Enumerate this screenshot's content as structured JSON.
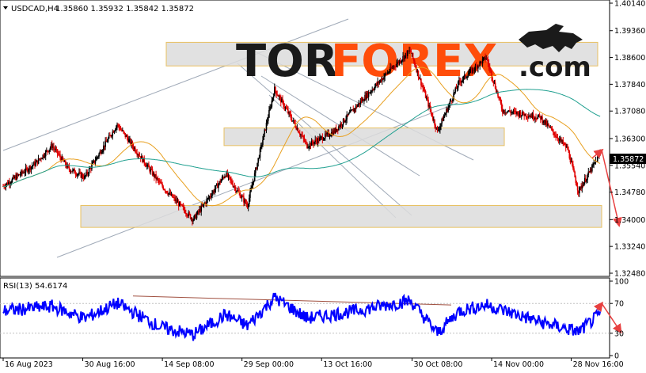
{
  "header": {
    "symbol": "USDCAD,H4",
    "ohlc": "1.35860 1.35932 1.35842 1.35872",
    "indicator": "RSI(13) 54.6174"
  },
  "logo": {
    "part1": "TOR",
    "part2": "FOREX",
    "part3": ".com"
  },
  "price_axis": {
    "ticks": [
      "1.40140",
      "1.39360",
      "1.38600",
      "1.37840",
      "1.37080",
      "1.36300",
      "1.35540",
      "1.34780",
      "1.34000",
      "1.33240",
      "1.32480"
    ],
    "current": "1.35872"
  },
  "rsi_axis": {
    "ticks": [
      "100",
      "70",
      "30",
      "0"
    ]
  },
  "time_axis": {
    "labels": [
      "16 Aug 2023",
      "30 Aug 16:00",
      "14 Sep 08:00",
      "29 Sep 00:00",
      "13 Oct 16:00",
      "30 Oct 08:00",
      "14 Nov 00:00",
      "28 Nov 16:00"
    ]
  },
  "colors": {
    "bull": "#000000",
    "bear": "#e00000",
    "ma_fast": "#e8a020",
    "ma_slow": "#20a090",
    "rsi": "#0000ff",
    "zone_fill": "#dcdcdc",
    "zone_border": "#e8c060",
    "forecast_arrow": "#e84040",
    "trendline": "#a0aab8",
    "rsi_trend": "#a05040"
  },
  "chart_data": [
    {
      "type": "candlestick",
      "title": "USDCAD,H4",
      "x_range": [
        "16 Aug 2023",
        "05 Dec 2023"
      ],
      "ylim": [
        1.3248,
        1.4014
      ],
      "grid": false,
      "waypoints": [
        {
          "t": "16 Aug 2023",
          "price": 1.3495
        },
        {
          "t": "22 Aug 2023",
          "price": 1.356
        },
        {
          "t": "25 Aug 2023",
          "price": 1.361
        },
        {
          "t": "28 Aug 2023",
          "price": 1.3545
        },
        {
          "t": "31 Aug 2023",
          "price": 1.352
        },
        {
          "t": "06 Sep 2023",
          "price": 1.367
        },
        {
          "t": "14 Sep 2023",
          "price": 1.35
        },
        {
          "t": "20 Sep 2023",
          "price": 1.34
        },
        {
          "t": "26 Sep 2023",
          "price": 1.353
        },
        {
          "t": "30 Sep 2023",
          "price": 1.344
        },
        {
          "t": "05 Oct 2023",
          "price": 1.377
        },
        {
          "t": "11 Oct 2023",
          "price": 1.361
        },
        {
          "t": "16 Oct 2023",
          "price": 1.365
        },
        {
          "t": "20 Oct 2023",
          "price": 1.372
        },
        {
          "t": "26 Oct 2023",
          "price": 1.382
        },
        {
          "t": "30 Oct 2023",
          "price": 1.388
        },
        {
          "t": "04 Nov 2023",
          "price": 1.365
        },
        {
          "t": "08 Nov 2023",
          "price": 1.379
        },
        {
          "t": "13 Nov 2023",
          "price": 1.386
        },
        {
          "t": "16 Nov 2023",
          "price": 1.371
        },
        {
          "t": "23 Nov 2023",
          "price": 1.369
        },
        {
          "t": "28 Nov 2023",
          "price": 1.36
        },
        {
          "t": "30 Nov 2023",
          "price": 1.348
        },
        {
          "t": "04 Dec 2023",
          "price": 1.3587
        }
      ],
      "last_price": 1.35872,
      "zones": [
        [
          1.3836,
          1.3903
        ],
        [
          1.361,
          1.366
        ],
        [
          1.3378,
          1.344
        ]
      ],
      "forecast": [
        {
          "t": "04 Dec 2023",
          "price": 1.359
        },
        {
          "t": "06 Dec 2023",
          "price": 1.3385
        }
      ]
    },
    {
      "type": "line",
      "title": "RSI(13) 54.6174",
      "ylim": [
        0,
        100
      ],
      "levels": [
        70,
        30
      ],
      "waypoints": [
        {
          "t": "16 Aug 2023",
          "value": 60
        },
        {
          "t": "25 Aug 2023",
          "value": 66
        },
        {
          "t": "31 Aug 2023",
          "value": 50
        },
        {
          "t": "06 Sep 2023",
          "value": 70
        },
        {
          "t": "14 Sep 2023",
          "value": 38
        },
        {
          "t": "20 Sep 2023",
          "value": 28
        },
        {
          "t": "26 Sep 2023",
          "value": 55
        },
        {
          "t": "30 Sep 2023",
          "value": 40
        },
        {
          "t": "05 Oct 2023",
          "value": 78
        },
        {
          "t": "11 Oct 2023",
          "value": 50
        },
        {
          "t": "20 Oct 2023",
          "value": 60
        },
        {
          "t": "30 Oct 2023",
          "value": 74
        },
        {
          "t": "04 Nov 2023",
          "value": 30
        },
        {
          "t": "08 Nov 2023",
          "value": 60
        },
        {
          "t": "13 Nov 2023",
          "value": 68
        },
        {
          "t": "23 Nov 2023",
          "value": 45
        },
        {
          "t": "30 Nov 2023",
          "value": 32
        },
        {
          "t": "04 Dec 2023",
          "value": 55
        }
      ],
      "last_value": 54.6174,
      "forecast": [
        {
          "t": "04 Dec 2023",
          "value": 70
        },
        {
          "t": "06 Dec 2023",
          "value": 32
        }
      ]
    }
  ]
}
